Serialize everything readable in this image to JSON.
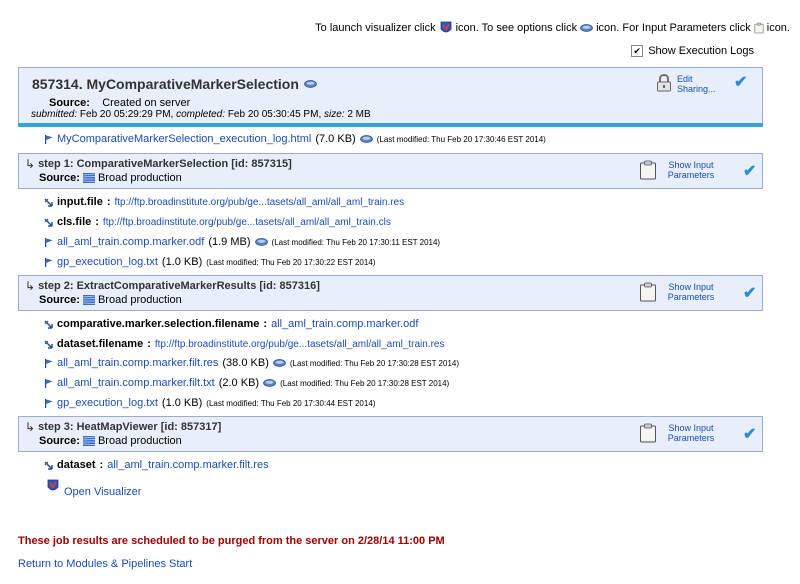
{
  "header": {
    "launch_prefix": "To launch visualizer click",
    "options_prefix": "icon. To see options click",
    "params_prefix": "icon. For Input Parameters click",
    "params_suffix": "icon.",
    "show_logs_label": "Show Execution Logs",
    "show_logs_checked": true
  },
  "job": {
    "title": "857314. MyComparativeMarkerSelection",
    "source_label": "Source:",
    "source_value": "Created on server",
    "submitted_label": "submitted:",
    "submitted_value": "Feb 20 05:29:29 PM",
    "completed_label": "completed:",
    "completed_value": "Feb 20 05:30:45 PM",
    "size_label": "size:",
    "size_value": "2 MB",
    "edit_label": "Edit",
    "sharing_label": "Sharing...",
    "log_file": "MyComparativeMarkerSelection_execution_log.html",
    "log_size": "(7.0 KB)",
    "log_modified": "(Last modified: Thu Feb 20 17:30:46 EST 2014)"
  },
  "steps": [
    {
      "title": "step 1: ComparativeMarkerSelection [id: 857315]",
      "source_label": "Source:",
      "source_value": "Broad production",
      "show_params": "Show Input",
      "show_params2": "Parameters",
      "inputs": [
        {
          "name": "input.file",
          "value": "ftp://ftp.broadinstitute.org/pub/ge...tasets/all_aml/all_aml_train.res"
        },
        {
          "name": "cls.file",
          "value": "ftp://ftp.broadinstitute.org/pub/ge...tasets/all_aml/all_aml_train.cls"
        }
      ],
      "outputs": [
        {
          "file": "all_aml_train.comp.marker.odf",
          "size": "(1.9 MB)",
          "modified": "(Last modified: Thu Feb 20 17:30:11 EST 2014)",
          "eye": true
        },
        {
          "file": "gp_execution_log.txt",
          "size": "(1.0 KB)",
          "modified": "(Last modified: Thu Feb 20 17:30:22 EST 2014)",
          "eye": false
        }
      ]
    },
    {
      "title": "step 2: ExtractComparativeMarkerResults [id: 857316]",
      "source_label": "Source:",
      "source_value": "Broad production",
      "show_params": "Show Input",
      "show_params2": "Parameters",
      "inputs": [
        {
          "name": "comparative.marker.selection.filename",
          "value": "all_aml_train.comp.marker.odf"
        },
        {
          "name": "dataset.filename",
          "value": "ftp://ftp.broadinstitute.org/pub/ge...tasets/all_aml/all_aml_train.res"
        }
      ],
      "outputs": [
        {
          "file": "all_aml_train.comp.marker.filt.res",
          "size": "(38.0 KB)",
          "modified": "(Last modified: Thu Feb 20 17:30:28 EST 2014)",
          "eye": true
        },
        {
          "file": "all_aml_train.comp.marker.filt.txt",
          "size": "(2.0 KB)",
          "modified": "(Last modified: Thu Feb 20 17:30:28 EST 2014)",
          "eye": true
        },
        {
          "file": "gp_execution_log.txt",
          "size": "(1.0 KB)",
          "modified": "(Last modified: Thu Feb 20 17:30:44 EST 2014)",
          "eye": false
        }
      ]
    },
    {
      "title": "step 3: HeatMapViewer [id: 857317]",
      "source_label": "Source:",
      "source_value": "Broad production",
      "show_params": "Show Input",
      "show_params2": "Parameters",
      "inputs": [
        {
          "name": "dataset",
          "value": "all_aml_train.comp.marker.filt.res"
        }
      ],
      "outputs": []
    }
  ],
  "open_visualizer": "Open Visualizer",
  "purge": {
    "prefix": "These job results are scheduled to be purged from the server on 2/28/14",
    "time": "11:00 PM"
  },
  "return_link": "Return to Modules & Pipelines Start",
  "colors": {
    "header_bg": "#e8eefa",
    "link": "#1a4db3",
    "accent_bar": "#31a5dc",
    "purge_text": "#a00000",
    "check": "#2a8ed6"
  }
}
